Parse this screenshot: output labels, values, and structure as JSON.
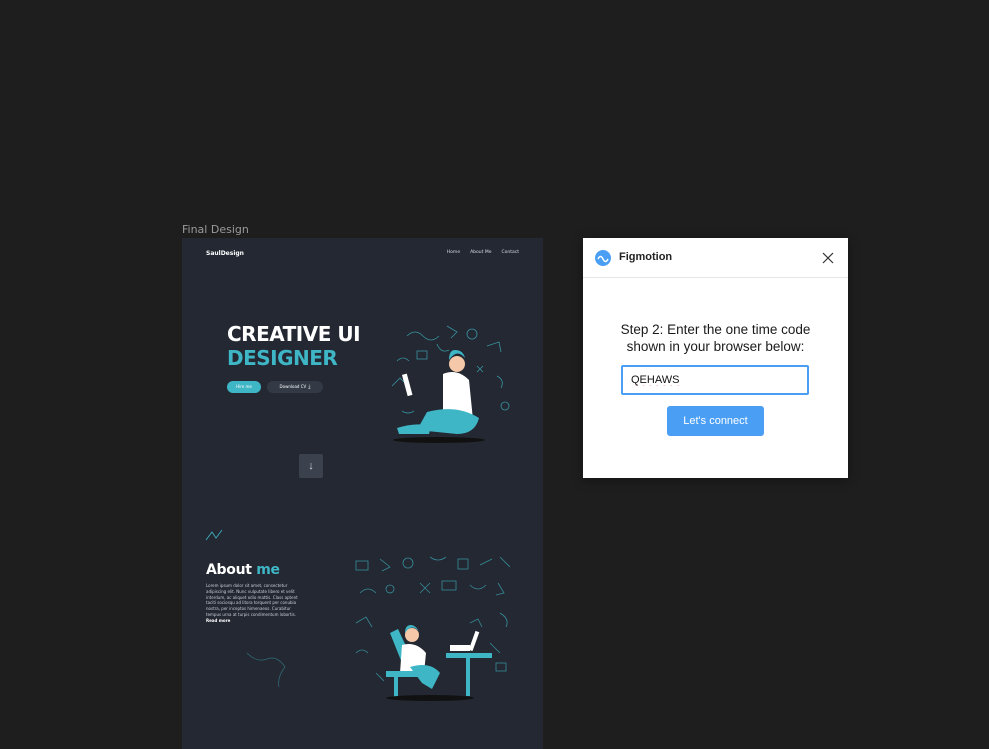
{
  "canvas": {
    "frame_label": "Final Design"
  },
  "site": {
    "logo": "SaulDesign",
    "nav": [
      "Home",
      "About Me",
      "Contact"
    ],
    "hero": {
      "title_line1": "CREATIVE UI",
      "title_line2": "DESIGNER",
      "hire_label": "Hire me",
      "download_label": "Download CV"
    },
    "about": {
      "title": "About",
      "title_accent": "me",
      "body": "Lorem ipsum dolor sit amet, consectetur adipiscing elit. Nunc vulputate libero et velit interdum, ac aliquet odio mattis. Class aptent taciti sociosqu ad litora torquent per conubia nostra, per inceptos himenaeos. Curabitur tempus urna at turpis condimentum lobortis.",
      "read_more": "Read more"
    }
  },
  "dialog": {
    "title": "Figmotion",
    "step_line1": "Step 2: Enter the one time code",
    "step_line2": "shown in your browser below:",
    "code_value": "QEHAWS",
    "connect_label": "Let's connect"
  },
  "colors": {
    "canvas_bg": "#1e1e1e",
    "frame_bg": "#232832",
    "accent": "#3fb6c6",
    "dialog_primary": "#4a9ff5"
  },
  "icons": {
    "scroll": "arrow-down-icon",
    "close": "close-icon",
    "download": "download-icon",
    "plugin_logo": "figmotion-logo-icon"
  }
}
